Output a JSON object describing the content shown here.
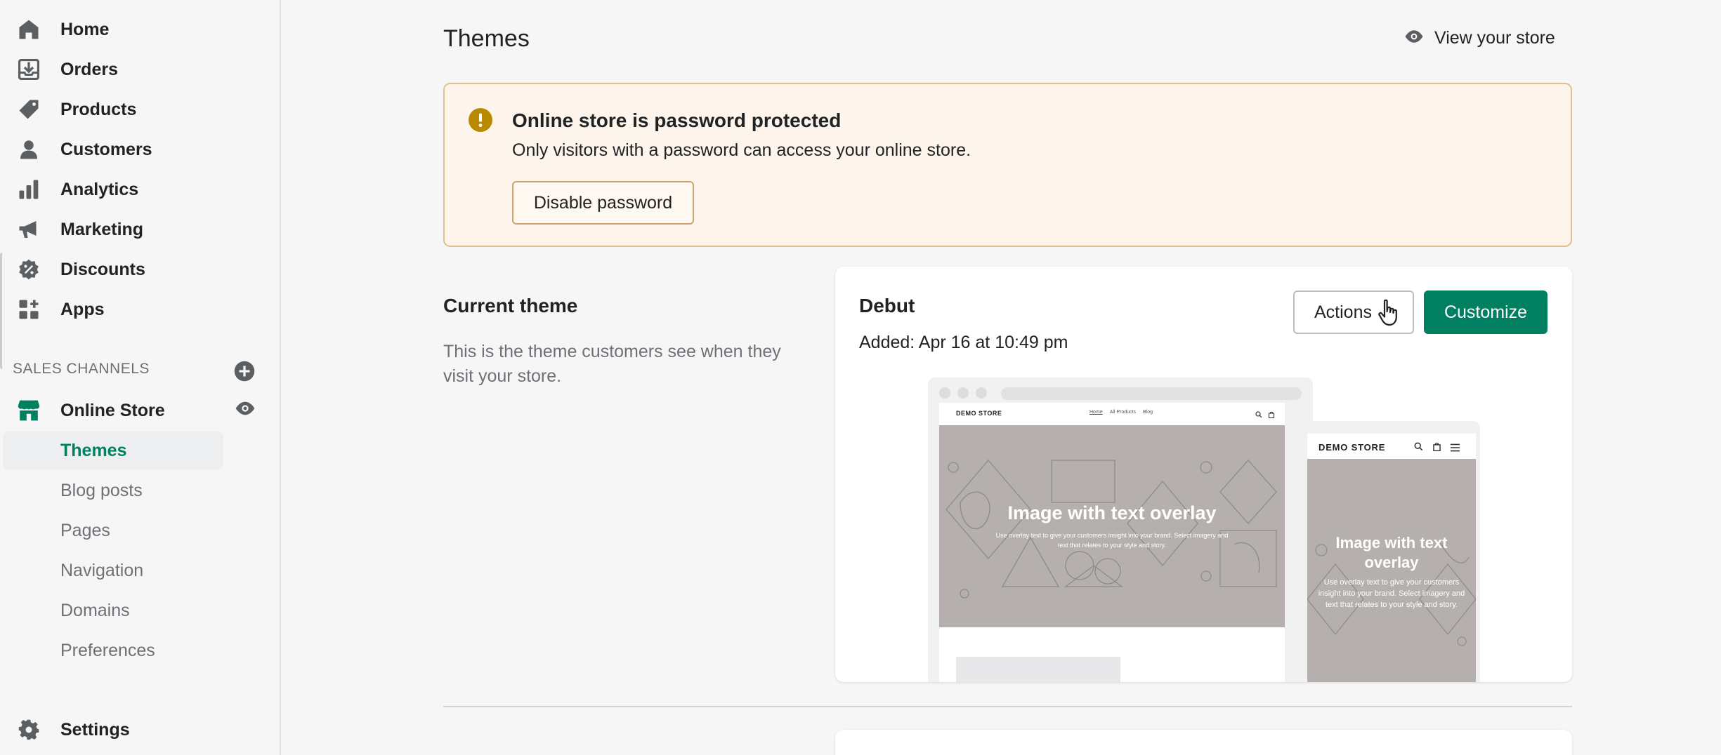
{
  "sidebar": {
    "items": [
      {
        "label": "Home",
        "icon": "home-icon"
      },
      {
        "label": "Orders",
        "icon": "orders-icon"
      },
      {
        "label": "Products",
        "icon": "tag-icon"
      },
      {
        "label": "Customers",
        "icon": "person-icon"
      },
      {
        "label": "Analytics",
        "icon": "bar-chart-icon"
      },
      {
        "label": "Marketing",
        "icon": "megaphone-icon"
      },
      {
        "label": "Discounts",
        "icon": "discount-icon"
      },
      {
        "label": "Apps",
        "icon": "apps-icon"
      }
    ],
    "sales_channels_header": "SALES CHANNELS",
    "online_store": "Online Store",
    "sub_items": [
      "Themes",
      "Blog posts",
      "Pages",
      "Navigation",
      "Domains",
      "Preferences"
    ],
    "active_sub_item": "Themes",
    "settings": "Settings"
  },
  "main": {
    "title": "Themes",
    "view_store": "View your store",
    "banner": {
      "title": "Online store is password protected",
      "text": "Only visitors with a password can access your online store.",
      "button": "Disable password"
    },
    "current_theme": {
      "title": "Current theme",
      "description": "This is the theme customers see when they visit your store."
    },
    "theme_card": {
      "name": "Debut",
      "added": "Added: Apr 16 at 10:49 pm",
      "actions_button": "Actions",
      "customize_button": "Customize",
      "preview": {
        "store_name": "DEMO STORE",
        "nav_links": [
          "Home",
          "All Products",
          "Blog"
        ],
        "hero_title": "Image with text overlay",
        "hero_text": "Use overlay text to give your customers insight into your brand. Select imagery and text that relates to your style and story."
      }
    }
  },
  "colors": {
    "accent": "#008060",
    "banner_bg": "#fdf5ec",
    "banner_border": "#e2c08c",
    "warning": "#b98900",
    "hero_gray": "#b5b0ae"
  }
}
